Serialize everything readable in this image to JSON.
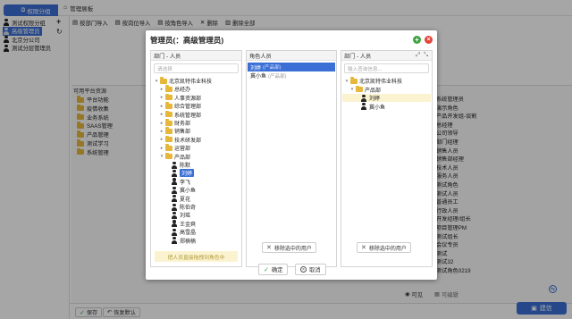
{
  "left": {
    "role_button": "权限分组",
    "roles": [
      "测试权限分组",
      "高级管理员",
      "北京分公司",
      "测试分层管理员"
    ],
    "selected_index": 1
  },
  "tab": {
    "label": "管理展板"
  },
  "toolbar": [
    "按部门导入",
    "按岗位导入",
    "按角色导入",
    "删除",
    "删除全部"
  ],
  "bg": {
    "section_label": "可用平台资源",
    "resources": [
      "平台功能",
      "疫情收集",
      "业务系统",
      "SAAS管理",
      "产品管理",
      "测试学习",
      "系统管理"
    ],
    "right_roles": [
      "系统管理员",
      "演示角色",
      "产品开发组-谈割",
      "总经理",
      "公司领导",
      "部门经理",
      "销售人员",
      "销售部经理",
      "技术人员",
      "服务人员",
      "测试角色",
      "测试人员",
      "普通员工",
      "行政人员",
      "开发经理/组长",
      "项目管理PM",
      "测试组长",
      "会议专员",
      "测试",
      "测试32",
      "测试角色0219"
    ],
    "bottom_save": "保存",
    "bottom_reset": "恢复默认",
    "tab_visible": "可见",
    "tab_editable": "可编辑",
    "jianxin": "建信"
  },
  "modal": {
    "title": "管理员(：高级管理员)",
    "col1": {
      "header": "部门 - 人员",
      "search_placeholder": "请选择",
      "root": "北京凯特伟业科技",
      "depts": [
        "总经办",
        "人事资源部",
        "综合管理部",
        "系统管理部",
        "财务部",
        "销售部",
        "技术研发部",
        "运营部",
        "产品部"
      ],
      "members": [
        "陈默",
        "刘婷",
        "李飞",
        "冀小鱼",
        "夏花",
        "陈伯奇",
        "刘瑶",
        "王金爽",
        "高雪晶",
        "郑楠楠"
      ],
      "selected_member_index": 1,
      "hint": "把人员直接拖拽到角色中"
    },
    "col2": {
      "header": "角色人员",
      "items": [
        {
          "name": "刘婷",
          "sub": "(产品部)"
        },
        {
          "name": "冀小鱼",
          "sub": "(产品部)"
        }
      ],
      "remove_label": "移除选中的用户"
    },
    "col3": {
      "header": "部门 - 人员",
      "search_placeholder": "输入查询信息...",
      "root": "北京凯特伟业科技",
      "dept": "产品部",
      "members": [
        "刘婷",
        "冀小鱼"
      ],
      "remove_label": "移除选中的用户"
    },
    "confirm": "确定",
    "cancel": "取消"
  },
  "colors": {
    "accent": "#3b6fd6",
    "folder": "#e5b73b",
    "hint_bg": "#fbf3d0",
    "plus": "#3fa33f",
    "close": "#e0443c"
  }
}
